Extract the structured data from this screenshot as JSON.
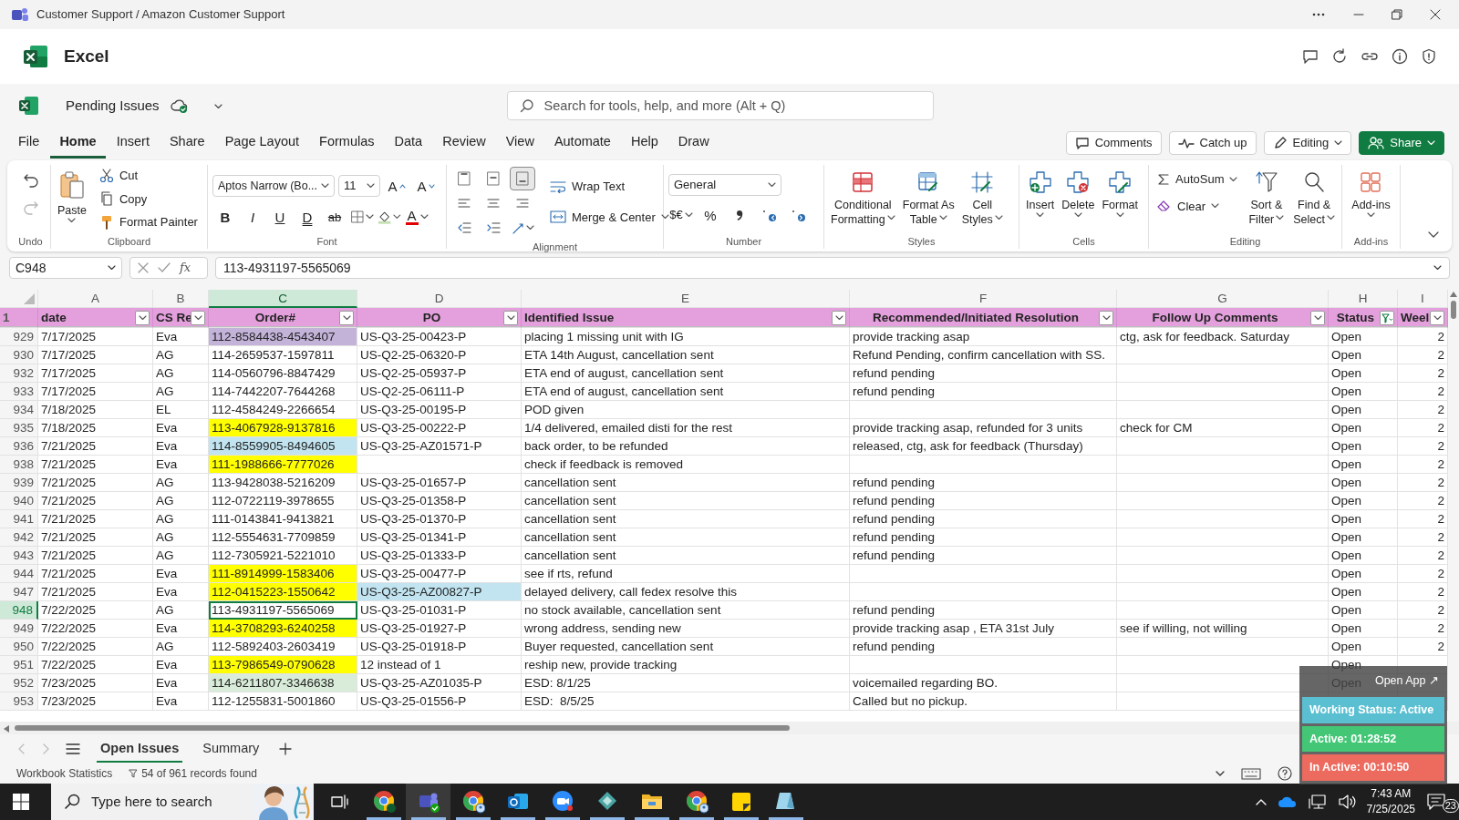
{
  "window": {
    "title": "Customer Support / Amazon Customer Support"
  },
  "app": {
    "name": "Excel"
  },
  "document": {
    "name": "Pending Issues"
  },
  "search": {
    "placeholder": "Search for tools, help, and more (Alt + Q)"
  },
  "menu_tabs": [
    {
      "label": "File",
      "selected": false
    },
    {
      "label": "Home",
      "selected": true
    },
    {
      "label": "Insert",
      "selected": false
    },
    {
      "label": "Share",
      "selected": false
    },
    {
      "label": "Page Layout",
      "selected": false
    },
    {
      "label": "Formulas",
      "selected": false
    },
    {
      "label": "Data",
      "selected": false
    },
    {
      "label": "Review",
      "selected": false
    },
    {
      "label": "View",
      "selected": false
    },
    {
      "label": "Automate",
      "selected": false
    },
    {
      "label": "Help",
      "selected": false
    },
    {
      "label": "Draw",
      "selected": false
    }
  ],
  "header_buttons": [
    {
      "label": "Comments",
      "kind": "comments"
    },
    {
      "label": "Catch up",
      "kind": "catchup"
    },
    {
      "label": "Editing",
      "kind": "editing"
    },
    {
      "label": "Share",
      "kind": "share"
    }
  ],
  "ribbon": {
    "undo": {
      "label": "Undo",
      "redo_disabled": true
    },
    "clipboard": {
      "label": "Clipboard",
      "paste": "Paste",
      "cut": "Cut",
      "copy": "Copy",
      "format_painter": "Format Painter"
    },
    "font": {
      "label": "Font",
      "name": "Aptos Narrow (Bo...",
      "size": "11",
      "grow": "A",
      "shrink": "A",
      "styles": [
        {
          "glyph": "B",
          "kind": "bold"
        },
        {
          "glyph": "I",
          "kind": "italic"
        },
        {
          "glyph": "U",
          "kind": "underline"
        },
        {
          "glyph": "D",
          "kind": "double"
        },
        {
          "glyph": "ab",
          "kind": "strike"
        }
      ],
      "font_color": "A"
    },
    "alignment": {
      "label": "Alignment",
      "vertical": [
        {
          "selected": false
        },
        {
          "selected": false
        },
        {
          "selected": true
        }
      ],
      "wrap": "Wrap Text",
      "merge": "Merge & Center"
    },
    "number": {
      "label": "Number",
      "format": "General",
      "currency": "$€",
      "percent": "%"
    },
    "styles": {
      "label": "Styles",
      "buttons": [
        {
          "lines": [
            "Conditional",
            "Formatting"
          ],
          "kind": "conditional"
        },
        {
          "lines": [
            "Format As",
            "Table"
          ],
          "kind": "table"
        },
        {
          "lines": [
            "Cell",
            "Styles"
          ],
          "kind": "cellstyles"
        }
      ]
    },
    "cells": {
      "label": "Cells",
      "buttons": [
        {
          "label": "Insert",
          "kind": "insert"
        },
        {
          "label": "Delete",
          "kind": "delete"
        },
        {
          "label": "Format",
          "kind": "format"
        }
      ]
    },
    "editing": {
      "label": "Editing",
      "autosum": "AutoSum",
      "clear": "Clear",
      "buttons": [
        {
          "lines": [
            "Sort &",
            "Filter"
          ],
          "kind": "sort"
        },
        {
          "lines": [
            "Find &",
            "Select"
          ],
          "kind": "find"
        }
      ]
    },
    "addins": {
      "label": "Add-ins",
      "button": "Add-ins"
    }
  },
  "formula_bar": {
    "name_box": "C948",
    "fx": "fx",
    "formula": "113-4931197-5565069"
  },
  "columns": [
    {
      "letter": "A",
      "selected": false
    },
    {
      "letter": "B",
      "selected": false
    },
    {
      "letter": "C",
      "selected": true
    },
    {
      "letter": "D",
      "selected": false
    },
    {
      "letter": "E",
      "selected": false
    },
    {
      "letter": "F",
      "selected": false
    },
    {
      "letter": "G",
      "selected": false
    },
    {
      "letter": "H",
      "selected": false
    },
    {
      "letter": "I",
      "selected": false
    }
  ],
  "header_row": {
    "row": "1",
    "cells": [
      {
        "text": "date",
        "filtered": false
      },
      {
        "text": "CS Re",
        "filtered": false
      },
      {
        "text": "Order#",
        "filtered": false
      },
      {
        "text": "PO",
        "filtered": false
      },
      {
        "text": "Identified Issue",
        "filtered": false
      },
      {
        "text": "Recommended/Initiated Resolution",
        "filtered": false
      },
      {
        "text": "Follow Up Comments",
        "filtered": false
      },
      {
        "text": "Status",
        "filtered": true
      },
      {
        "text": "Weel",
        "filtered": false
      }
    ]
  },
  "rows": [
    {
      "row": "929",
      "selected": false,
      "date": "7/17/2025",
      "rep": "Eva",
      "order": {
        "text": "112-8584438-4543407",
        "color": "#c3b3d9"
      },
      "po": "US-Q3-25-00423-P",
      "issue": "placing 1 missing unit with IG",
      "resolution": "provide tracking asap",
      "follow_up": "ctg, ask for feedback. Saturday",
      "status": "Open",
      "week": "2"
    },
    {
      "row": "930",
      "selected": false,
      "date": "7/17/2025",
      "rep": "AG",
      "order": "114-2659537-1597811",
      "po": "US-Q2-25-06320-P",
      "issue": "ETA 14th August, cancellation sent",
      "resolution": "Refund Pending, confirm cancellation with SS.",
      "status": "Open",
      "week": "2"
    },
    {
      "row": "932",
      "selected": false,
      "date": "7/17/2025",
      "rep": "AG",
      "order": "114-0560796-8847429",
      "po": "US-Q2-25-05937-P",
      "issue": "ETA end of august, cancellation sent",
      "resolution": "refund pending",
      "status": "Open",
      "week": "2"
    },
    {
      "row": "933",
      "selected": false,
      "date": "7/17/2025",
      "rep": "AG",
      "order": "114-7442207-7644268",
      "po": "US-Q2-25-06111-P",
      "issue": "ETA end of august, cancellation sent",
      "resolution": "refund pending",
      "status": "Open",
      "week": "2"
    },
    {
      "row": "934",
      "selected": false,
      "date": "7/18/2025",
      "rep": "EL",
      "order": "112-4584249-2266654",
      "po": "US-Q3-25-00195-P",
      "issue": "POD given",
      "status": "Open",
      "week": "2"
    },
    {
      "row": "935",
      "selected": false,
      "date": "7/18/2025",
      "rep": "Eva",
      "order": {
        "text": "113-4067928-9137816",
        "color": "#ffff00"
      },
      "po": "US-Q3-25-00222-P",
      "issue": "1/4 delivered, emailed disti for the rest",
      "resolution": "provide tracking asap, refunded for 3 units",
      "follow_up": "check for CM",
      "status": "Open",
      "week": "2"
    },
    {
      "row": "936",
      "selected": false,
      "date": "7/21/2025",
      "rep": "Eva",
      "order": {
        "text": "114-8559905-8494605",
        "color": "#c1e4f0"
      },
      "po": "US-Q3-25-AZ01571-P",
      "issue": "back order, to be refunded",
      "resolution": "released, ctg, ask for feedback (Thursday)",
      "status": "Open",
      "week": "2"
    },
    {
      "row": "938",
      "selected": false,
      "date": "7/21/2025",
      "rep": "Eva",
      "order": {
        "text": "111-1988666-7777026",
        "color": "#ffff00"
      },
      "issue": "check if feedback is removed",
      "status": "Open",
      "week": "2"
    },
    {
      "row": "939",
      "selected": false,
      "date": "7/21/2025",
      "rep": "AG",
      "order": "113-9428038-5216209",
      "po": "US-Q3-25-01657-P",
      "issue": "cancellation sent",
      "resolution": "refund pending",
      "status": "Open",
      "week": "2"
    },
    {
      "row": "940",
      "selected": false,
      "date": "7/21/2025",
      "rep": "AG",
      "order": "112-0722119-3978655",
      "po": "US-Q3-25-01358-P",
      "issue": "cancellation sent",
      "resolution": "refund pending",
      "status": "Open",
      "week": "2"
    },
    {
      "row": "941",
      "selected": false,
      "date": "7/21/2025",
      "rep": "AG",
      "order": "111-0143841-9413821",
      "po": "US-Q3-25-01370-P",
      "issue": "cancellation sent",
      "resolution": "refund pending",
      "status": "Open",
      "week": "2"
    },
    {
      "row": "942",
      "selected": false,
      "date": "7/21/2025",
      "rep": "AG",
      "order": "112-5554631-7709859",
      "po": "US-Q3-25-01341-P",
      "issue": "cancellation sent",
      "resolution": "refund pending",
      "status": "Open",
      "week": "2"
    },
    {
      "row": "943",
      "selected": false,
      "date": "7/21/2025",
      "rep": "AG",
      "order": "112-7305921-5221010",
      "po": "US-Q3-25-01333-P",
      "issue": "cancellation sent",
      "resolution": "refund pending",
      "status": "Open",
      "week": "2"
    },
    {
      "row": "944",
      "selected": false,
      "date": "7/21/2025",
      "rep": "Eva",
      "order": {
        "text": "111-8914999-1583406",
        "color": "#ffff00"
      },
      "po": "US-Q3-25-00477-P",
      "issue": "see if rts, refund",
      "status": "Open",
      "week": "2"
    },
    {
      "row": "947",
      "selected": false,
      "date": "7/21/2025",
      "rep": "Eva",
      "order": {
        "text": "112-0415223-1550642",
        "color": "#ffff00"
      },
      "po": {
        "text": "US-Q3-25-AZ00827-P",
        "color": "#c1e4f0"
      },
      "issue": "delayed delivery, call fedex resolve this",
      "status": "Open",
      "week": "2"
    },
    {
      "row": "948",
      "selected": true,
      "date": "7/22/2025",
      "rep": "AG",
      "order": "113-4931197-5565069",
      "po": "US-Q3-25-01031-P",
      "issue": "no stock available, cancellation sent",
      "resolution": "refund pending",
      "status": "Open",
      "week": "2"
    },
    {
      "row": "949",
      "selected": false,
      "date": "7/22/2025",
      "rep": "Eva",
      "order": {
        "text": "114-3708293-6240258",
        "color": "#ffff00"
      },
      "po": "US-Q3-25-01927-P",
      "issue": "wrong address, sending new",
      "resolution": "provide tracking asap , ETA 31st July",
      "follow_up": "see if willing, not willing",
      "status": "Open",
      "week": "2"
    },
    {
      "row": "950",
      "selected": false,
      "date": "7/22/2025",
      "rep": "AG",
      "order": "112-5892403-2603419",
      "po": "US-Q3-25-01918-P",
      "issue": "Buyer requested, cancellation sent",
      "resolution": "refund pending",
      "status": "Open",
      "week": "2"
    },
    {
      "row": "951",
      "selected": false,
      "date": "7/22/2025",
      "rep": "Eva",
      "order": {
        "text": "113-7986549-0790628",
        "color": "#ffff00"
      },
      "po": "12 instead of 1",
      "issue": "reship new, provide tracking",
      "status": "Open"
    },
    {
      "row": "952",
      "selected": false,
      "date": "7/23/2025",
      "rep": "Eva",
      "order": {
        "text": "114-6211807-3346638",
        "color": "#d9ecd9"
      },
      "po": "US-Q3-25-AZ01035-P",
      "issue": "ESD: 8/1/25",
      "resolution": "voicemailed regarding BO.",
      "status": "Open"
    },
    {
      "row": "953",
      "selected": false,
      "date": "7/23/2025",
      "rep": "Eva",
      "order": "112-1255831-5001860",
      "po": "US-Q3-25-01556-P",
      "issue": "ESD:  8/5/25",
      "resolution": "Called but no pickup."
    }
  ],
  "sheet_tabs": [
    {
      "label": "Open Issues",
      "selected": true
    },
    {
      "label": "Summary",
      "selected": false
    }
  ],
  "status_bar": {
    "label": "Workbook Statistics",
    "records": "54 of 961 records found"
  },
  "tracker": {
    "link": "Open App ↗",
    "status": "Working Status: Active",
    "active": "Active: 01:28:52",
    "inactive": "In Active: 00:10:50"
  },
  "taskbar": {
    "search_placeholder": "Type here to search",
    "time": "7:43 AM",
    "date": "7/25/2025",
    "notifications": "23",
    "apps": [
      {
        "kind": "browser-badge",
        "selected": false,
        "running": true
      },
      {
        "kind": "chat",
        "selected": true,
        "running": true
      },
      {
        "kind": "browser-profile",
        "selected": false,
        "running": true
      },
      {
        "kind": "mail",
        "selected": false,
        "running": true
      },
      {
        "kind": "video",
        "selected": false,
        "running": true
      },
      {
        "kind": "diamond",
        "selected": false,
        "running": true
      },
      {
        "kind": "folder",
        "selected": false,
        "running": true
      },
      {
        "kind": "browser-profile",
        "selected": false,
        "running": true
      },
      {
        "kind": "note",
        "selected": false,
        "running": true
      },
      {
        "kind": "prism",
        "selected": false,
        "running": true
      }
    ]
  }
}
